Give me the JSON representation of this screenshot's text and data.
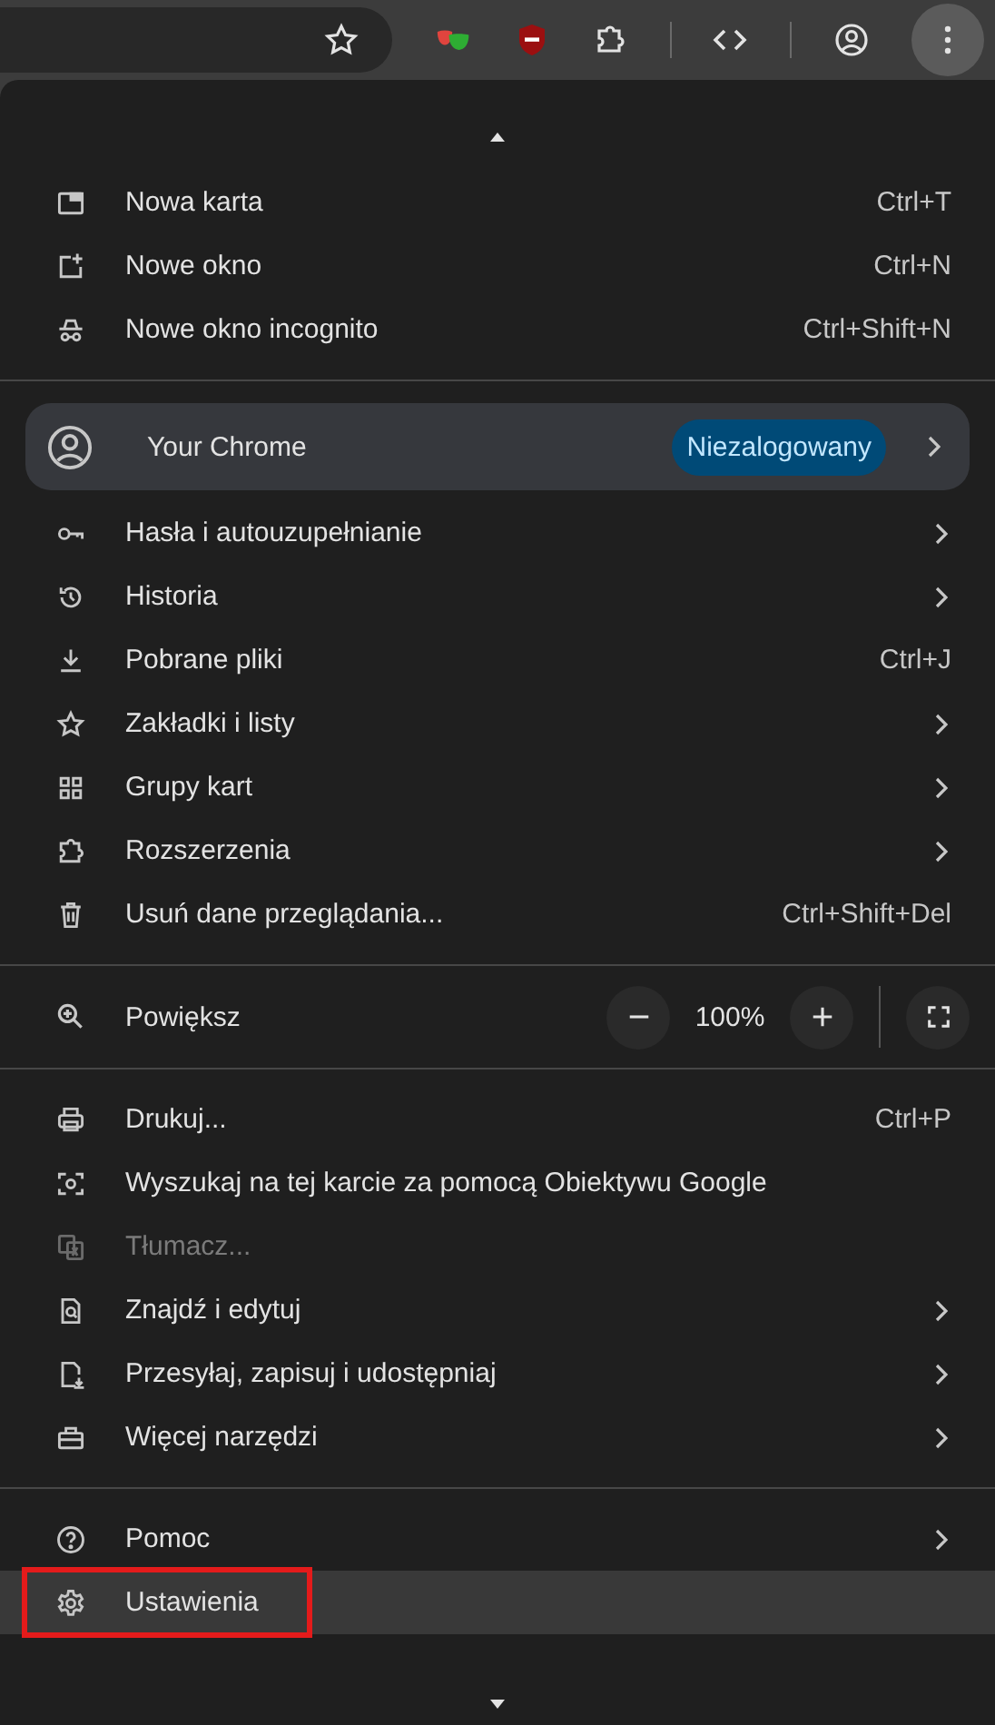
{
  "menu": {
    "section_1": [
      {
        "label": "Nowa karta",
        "shortcut": "Ctrl+T",
        "submenu": false,
        "disabled": false,
        "highlighted": false,
        "annotated": false
      },
      {
        "label": "Nowe okno",
        "shortcut": "Ctrl+N",
        "submenu": false,
        "disabled": false,
        "highlighted": false,
        "annotated": false
      },
      {
        "label": "Nowe okno incognito",
        "shortcut": "Ctrl+Shift+N",
        "submenu": false,
        "disabled": false,
        "highlighted": false,
        "annotated": false
      }
    ],
    "profile": {
      "label": "Your Chrome",
      "badge": "Niezalogowany"
    },
    "section_2": [
      {
        "label": "Hasła i autouzupełnianie",
        "submenu": true,
        "disabled": false,
        "highlighted": false,
        "annotated": false
      },
      {
        "label": "Historia",
        "submenu": true,
        "disabled": false,
        "highlighted": false,
        "annotated": false
      },
      {
        "label": "Pobrane pliki",
        "shortcut": "Ctrl+J",
        "submenu": false,
        "disabled": false,
        "highlighted": false,
        "annotated": false
      },
      {
        "label": "Zakładki i listy",
        "submenu": true,
        "disabled": false,
        "highlighted": false,
        "annotated": false
      },
      {
        "label": "Grupy kart",
        "submenu": true,
        "disabled": false,
        "highlighted": false,
        "annotated": false
      },
      {
        "label": "Rozszerzenia",
        "submenu": true,
        "disabled": false,
        "highlighted": false,
        "annotated": false
      },
      {
        "label": "Usuń dane przeglądania...",
        "shortcut": "Ctrl+Shift+Del",
        "submenu": false,
        "disabled": false,
        "highlighted": false,
        "annotated": false
      }
    ],
    "zoom": {
      "label": "Powiększ",
      "value": "100%"
    },
    "section_3": [
      {
        "label": "Drukuj...",
        "shortcut": "Ctrl+P",
        "submenu": false,
        "disabled": false,
        "highlighted": false,
        "annotated": false
      },
      {
        "label": "Wyszukaj na tej karcie za pomocą Obiektywu Google",
        "submenu": false,
        "disabled": false,
        "highlighted": false,
        "annotated": false
      },
      {
        "label": "Tłumacz...",
        "submenu": false,
        "disabled": true,
        "highlighted": false,
        "annotated": false
      },
      {
        "label": "Znajdź i edytuj",
        "submenu": true,
        "disabled": false,
        "highlighted": false,
        "annotated": false
      },
      {
        "label": "Przesyłaj, zapisuj i udostępniaj",
        "submenu": true,
        "disabled": false,
        "highlighted": false,
        "annotated": false
      },
      {
        "label": "Więcej narzędzi",
        "submenu": true,
        "disabled": false,
        "highlighted": false,
        "annotated": false
      }
    ],
    "section_4": [
      {
        "label": "Pomoc",
        "submenu": true,
        "disabled": false,
        "highlighted": false,
        "annotated": false
      },
      {
        "label": "Ustawienia",
        "submenu": false,
        "disabled": false,
        "highlighted": true,
        "annotated": true
      }
    ]
  }
}
